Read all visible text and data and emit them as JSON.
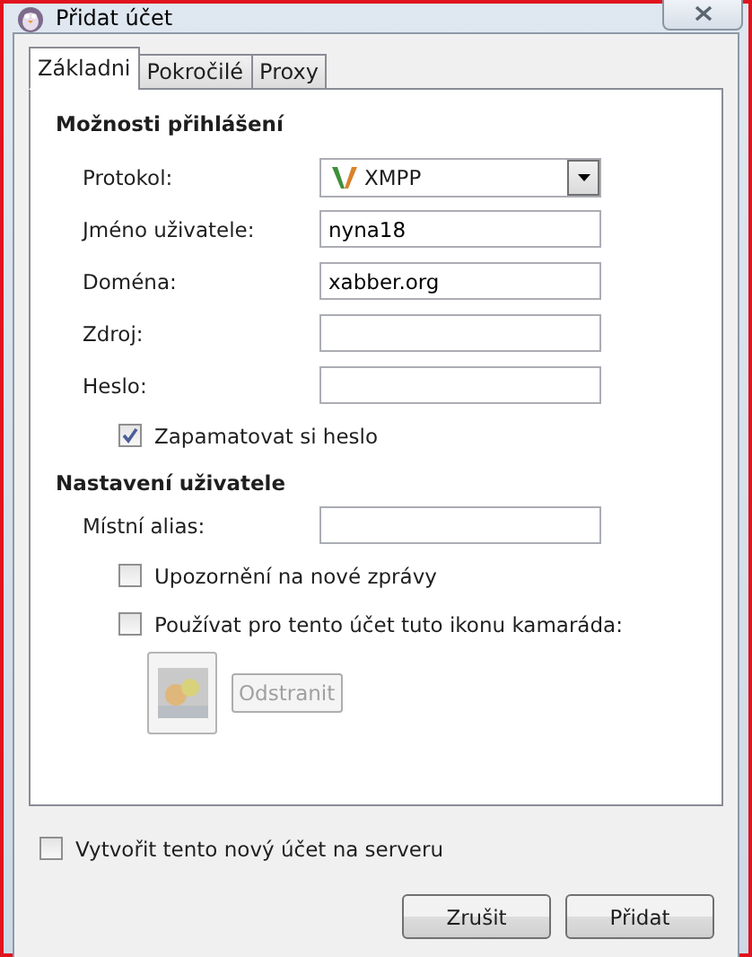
{
  "window": {
    "title": "Přidat účet"
  },
  "tabs": [
    {
      "label": "Základni",
      "selected": true
    },
    {
      "label": "Pokročilé",
      "selected": false
    },
    {
      "label": "Proxy",
      "selected": false
    }
  ],
  "login": {
    "heading": "Možnosti přihlášení",
    "protocol": {
      "label": "Protokol:",
      "value": "XMPP"
    },
    "fields": [
      {
        "label": "Jméno uživatele:",
        "value": "nyna18"
      },
      {
        "label": "Doména:",
        "value": "xabber.org"
      },
      {
        "label": "Zdroj:"
      },
      {
        "label": "Heslo:"
      }
    ],
    "remember": {
      "label": "Zapamatovat si heslo",
      "checked": true
    }
  },
  "user": {
    "heading": "Nastavení uživatele",
    "alias": {
      "label": "Místní alias:"
    },
    "options": [
      {
        "label": "Upozornění na nové zprávy",
        "checked": false
      },
      {
        "label": "Používat pro tento účet tuto ikonu kamaráda:",
        "checked": false
      }
    ],
    "remove_button": {
      "label": "Odstranit",
      "disabled": true
    }
  },
  "create_on_server": {
    "label": "Vytvořit tento nový účet na serveru",
    "checked": false
  },
  "buttons": [
    {
      "label": "Zrušit"
    },
    {
      "label": "Přidat"
    }
  ]
}
